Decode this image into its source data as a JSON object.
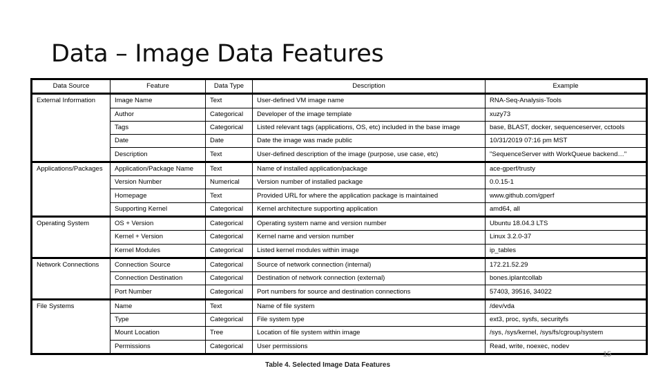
{
  "slide": {
    "title": "Data – Image Data Features",
    "caption": "Table 4. Selected Image Data Features",
    "page_number": "15"
  },
  "table": {
    "headers": [
      "Data Source",
      "Feature",
      "Data Type",
      "Description",
      "Example"
    ],
    "groups": [
      {
        "source": "External Information",
        "rows": [
          {
            "feature": "Image Name",
            "type": "Text",
            "description": "User-defined VM image name",
            "example": "RNA-Seq-Analysis-Tools"
          },
          {
            "feature": "Author",
            "type": "Categorical",
            "description": "Developer of the image template",
            "example": "xuzy73"
          },
          {
            "feature": "Tags",
            "type": "Categorical",
            "description": "Listed relevant tags (applications, OS, etc) included in the base image",
            "example": "base, BLAST, docker, sequenceserver, cctools"
          },
          {
            "feature": "Date",
            "type": "Date",
            "description": "Date the image was made public",
            "example": "10/31/2019 07:16 pm MST"
          },
          {
            "feature": "Description",
            "type": "Text",
            "description": "User-defined description of the image (purpose, use case, etc)",
            "example": "\"SequenceServer with WorkQueue backend…\""
          }
        ]
      },
      {
        "source": "Applications/Packages",
        "rows": [
          {
            "feature": "Application/Package Name",
            "type": "Text",
            "description": "Name of installed application/package",
            "example": "ace-gperf/trusty"
          },
          {
            "feature": "Version Number",
            "type": "Numerical",
            "description": "Version number of installed package",
            "example": "0.0.15-1"
          },
          {
            "feature": "Homepage",
            "type": "Text",
            "description": "Provided URL for where the application package is maintained",
            "example": "www.github.com/gperf"
          },
          {
            "feature": "Supporting Kernel",
            "type": "Categorical",
            "description": "Kernel architecture supporting application",
            "example": "amd64, all"
          }
        ]
      },
      {
        "source": "Operating System",
        "rows": [
          {
            "feature": "OS + Version",
            "type": "Categorical",
            "description": "Operating system name and version number",
            "example": "Ubuntu 18.04.3 LTS"
          },
          {
            "feature": "Kernel + Version",
            "type": "Categorical",
            "description": "Kernel name and version number",
            "example": "Linux 3.2.0-37"
          },
          {
            "feature": "Kernel Modules",
            "type": "Categorical",
            "description": "Listed kernel modules within image",
            "example": "ip_tables"
          }
        ]
      },
      {
        "source": "Network Connections",
        "rows": [
          {
            "feature": "Connection Source",
            "type": "Categorical",
            "description": "Source of network connection (internal)",
            "example": "172.21.52.29"
          },
          {
            "feature": "Connection Destination",
            "type": "Categorical",
            "description": "Destination of network connection (external)",
            "example": "bones.iplantcollab"
          },
          {
            "feature": "Port Number",
            "type": "Categorical",
            "description": "Port numbers for source and destination connections",
            "example": "57403, 39516, 34022"
          }
        ]
      },
      {
        "source": "File Systems",
        "rows": [
          {
            "feature": "Name",
            "type": "Text",
            "description": "Name of file system",
            "example": "/dev/vda"
          },
          {
            "feature": "Type",
            "type": "Categorical",
            "description": "File system type",
            "example": "ext3, proc, sysfs, securityfs"
          },
          {
            "feature": "Mount Location",
            "type": "Tree",
            "description": "Location of file system within image",
            "example": "/sys, /sys/kernel, /sys/fs/cgroup/system"
          },
          {
            "feature": "Permissions",
            "type": "Categorical",
            "description": "User permissions",
            "example": "Read, write, noexec, nodev"
          }
        ]
      }
    ]
  }
}
